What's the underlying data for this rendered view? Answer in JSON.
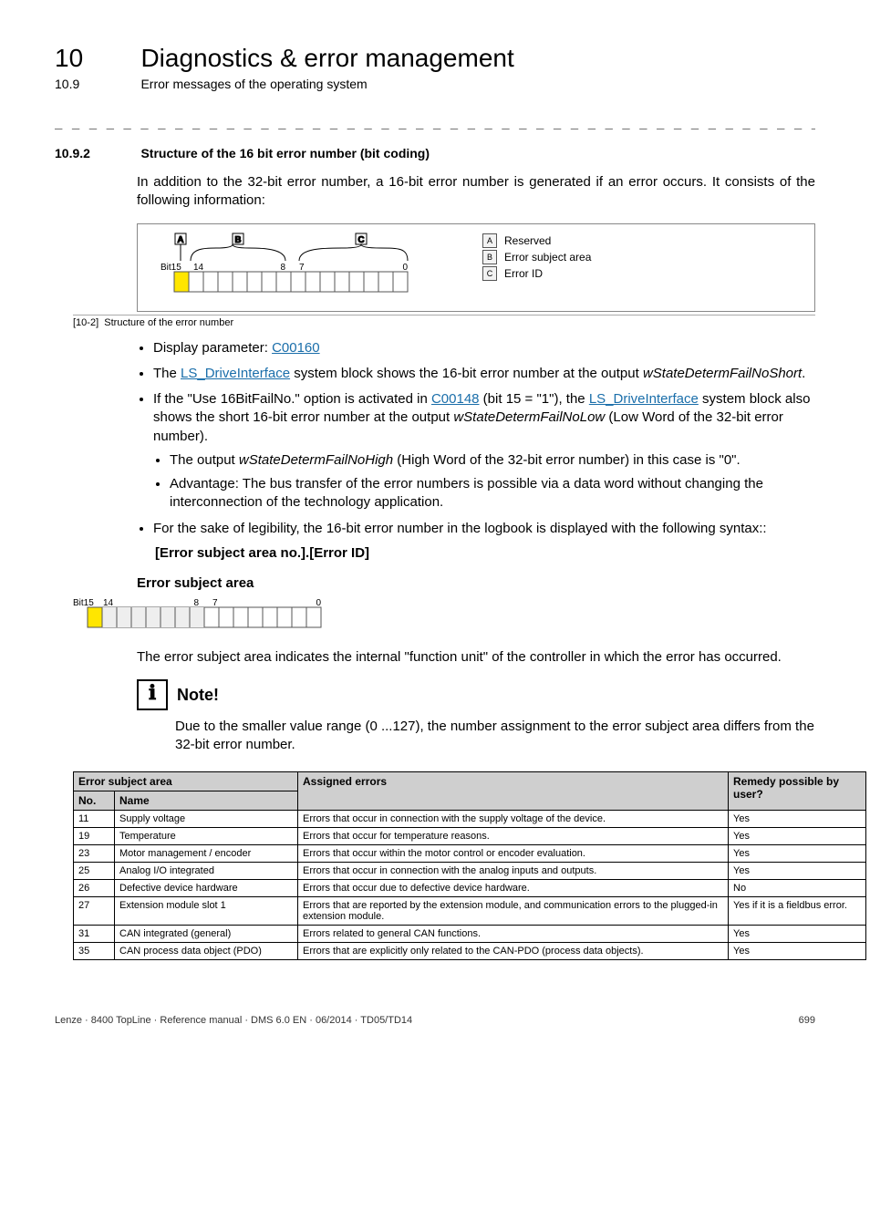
{
  "chapter": {
    "num": "10",
    "title": "Diagnostics & error management",
    "subnum": "10.9",
    "subtitle": "Error messages of the operating system"
  },
  "section": {
    "num": "10.9.2",
    "title": "Structure of the 16 bit error number (bit coding)"
  },
  "intro": "In addition to the 32-bit error number, a 16-bit error number is generated if an error occurs. It consists of the following information:",
  "fig": {
    "caption_id": "[10-2]",
    "caption_text": "Structure of the error number",
    "bit15": "Bit15",
    "b14": "14",
    "b8": "8",
    "b7": "7",
    "b0": "0",
    "legendA": "A",
    "legendB": "B",
    "legendC": "C",
    "legendA_text": "Reserved",
    "legendB_text": "Error subject area",
    "legendC_text": "Error ID"
  },
  "bullets": {
    "b1_pre": "Display parameter: ",
    "b1_link": "C00160",
    "b2_pre": "The ",
    "b2_link": "LS_DriveInterface",
    "b2_post1": " system block shows the 16-bit error number at the output ",
    "b2_ital": "wStateDetermFailNoShort",
    "b2_post2": ".",
    "b3_pre": "If the \"Use 16BitFailNo.\" option is activated in ",
    "b3_link1": "C00148",
    "b3_mid1": " (bit 15 = \"1\"), the ",
    "b3_link2": "LS_DriveInterface",
    "b3_mid2": " system block also shows the short 16-bit error number at the output ",
    "b3_ital": "wStateDetermFailNoLow",
    "b3_post": " (Low Word of the 32-bit error number).",
    "b3a_pre": "The output ",
    "b3a_ital": "wStateDetermFailNoHigh",
    "b3a_post": " (High Word of the 32-bit error number) in this case is \"0\".",
    "b3b": "Advantage: The bus transfer of the error numbers is possible via a data word without changing the interconnection of the technology application.",
    "b4": "For the sake of legibility, the 16-bit error number in the logbook is displayed with the following syntax::",
    "b4_code": "[Error subject area no.].[Error ID]"
  },
  "subhead_esa": "Error subject area",
  "esa_fig": {
    "bit15": "Bit15",
    "b14": "14",
    "b8": "8",
    "b7": "7",
    "b0": "0"
  },
  "esa_text": "The error subject area indicates the internal \"function unit\" of the controller in which the error has occurred.",
  "note": {
    "title": "Note!",
    "body": "Due to the smaller value range (0 ...127), the number assignment to the error subject area differs from the 32-bit error number."
  },
  "table": {
    "h_area": "Error subject area",
    "h_assigned": "Assigned errors",
    "h_remedy": "Remedy possible by user?",
    "h_no": "No.",
    "h_name": "Name",
    "rows": [
      {
        "no": "11",
        "name": "Supply voltage",
        "err": "Errors that occur in connection with the supply voltage of the device.",
        "rem": "Yes"
      },
      {
        "no": "19",
        "name": "Temperature",
        "err": "Errors that occur for temperature reasons.",
        "rem": "Yes"
      },
      {
        "no": "23",
        "name": "Motor management / encoder",
        "err": "Errors that occur within the motor control or encoder evaluation.",
        "rem": "Yes"
      },
      {
        "no": "25",
        "name": "Analog I/O integrated",
        "err": "Errors that occur in connection with the analog inputs and outputs.",
        "rem": "Yes"
      },
      {
        "no": "26",
        "name": "Defective device hardware",
        "err": "Errors that occur due to defective device hardware.",
        "rem": "No"
      },
      {
        "no": "27",
        "name": "Extension module slot 1",
        "err": "Errors that are reported by the extension module, and communication errors to the plugged-in extension module.",
        "rem": "Yes if it is a fieldbus error."
      },
      {
        "no": "31",
        "name": "CAN integrated (general)",
        "err": "Errors related to general CAN functions.",
        "rem": "Yes"
      },
      {
        "no": "35",
        "name": "CAN process data object (PDO)",
        "err": "Errors that are explicitly only related to the CAN-PDO (process data objects).",
        "rem": "Yes"
      }
    ]
  },
  "footer": {
    "left": "Lenze · 8400 TopLine · Reference manual · DMS 6.0 EN · 06/2014 · TD05/TD14",
    "right": "699"
  }
}
